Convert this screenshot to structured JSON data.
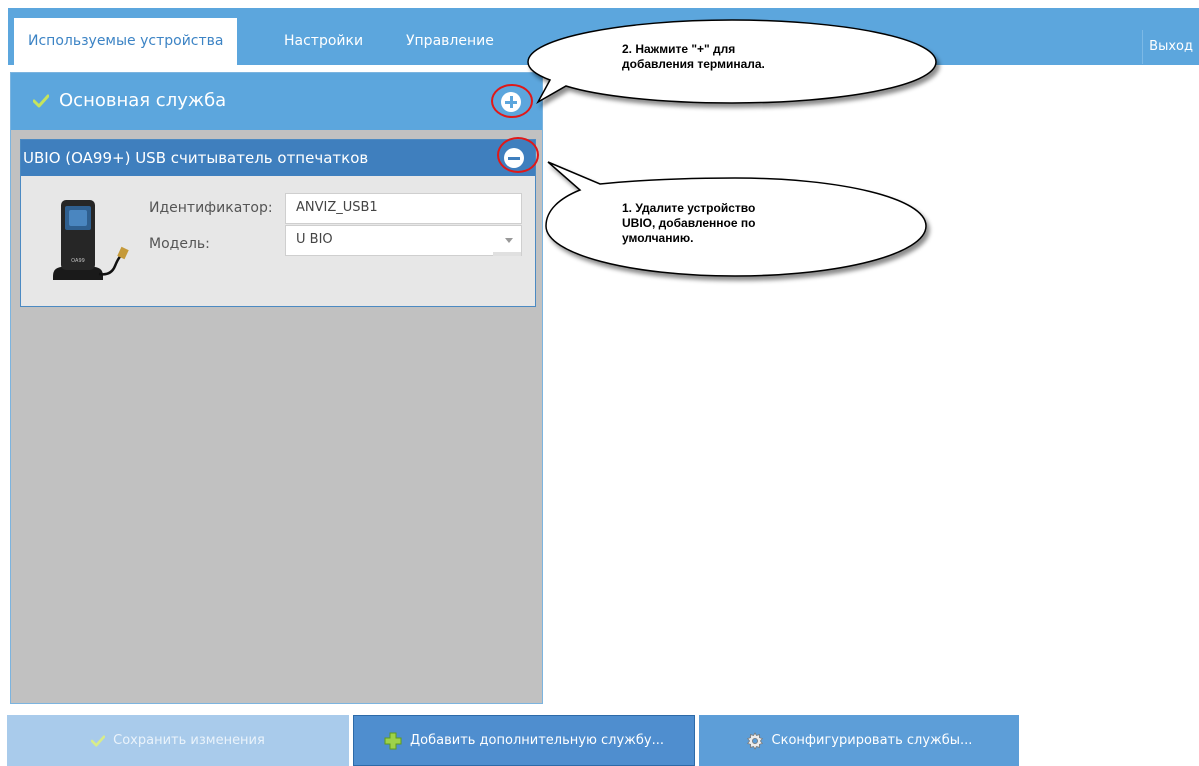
{
  "tabs": [
    {
      "label": "Используемые устройства",
      "active": true
    },
    {
      "label": "Настройки",
      "active": false
    },
    {
      "label": "Управление",
      "active": false
    }
  ],
  "exit_label": "Выход",
  "service": {
    "title": "Основная служба"
  },
  "device": {
    "title": "UBIO (OA99+) USB считыватель отпечатков",
    "image_label": "OA99",
    "id_label": "Идентификатор:",
    "id_value": "ANVIZ_USB1",
    "model_label": "Модель:",
    "model_value": "U BIO"
  },
  "callouts": {
    "add_hint_line1": "2. Нажмите \"+\" для",
    "add_hint_line2": "добавления терминала.",
    "remove_hint_line1": "1. Удалите устройство",
    "remove_hint_line2": "UBIO, добавленное по",
    "remove_hint_line3": "умолчанию."
  },
  "buttons": {
    "save": "Сохранить изменения",
    "add_service": "Добавить дополнительную службу...",
    "configure": "Сконфигурировать службы..."
  },
  "colors": {
    "header_blue": "#5ca6dd",
    "device_header_blue": "#3f7fbe",
    "highlight_red": "#e01818"
  }
}
